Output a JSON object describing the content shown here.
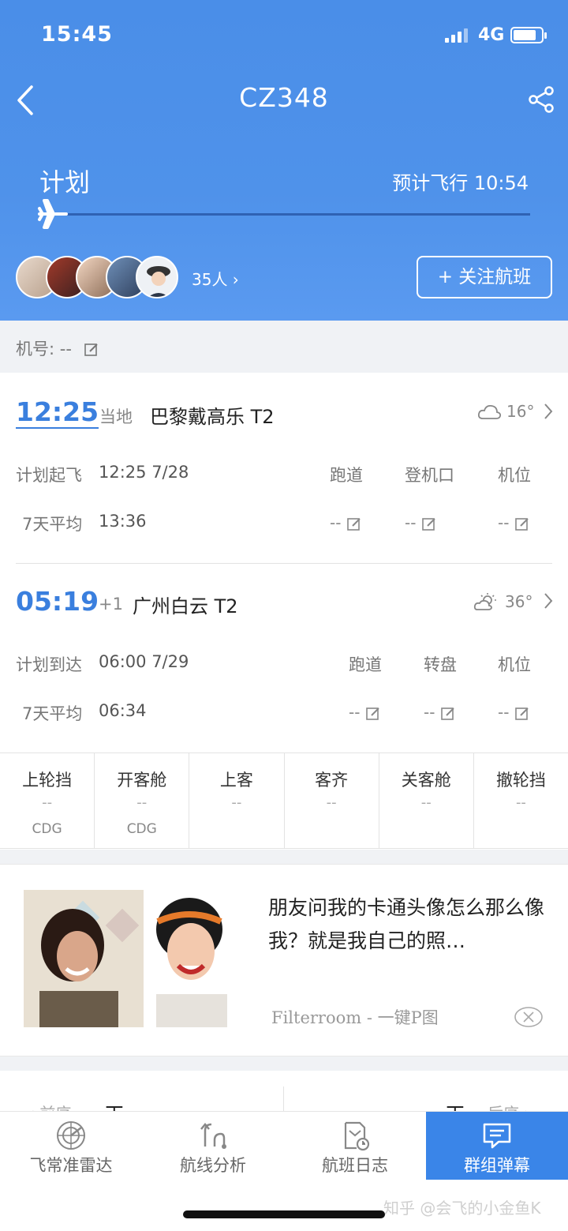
{
  "status_bar": {
    "time": "15:45",
    "network": "4G"
  },
  "header": {
    "flight_no": "CZ348",
    "status": "计划",
    "estimated": "预计飞行 10:54",
    "followers": "35人",
    "follow_button": "+ 关注航班"
  },
  "registration": {
    "label": "机号: --"
  },
  "departure": {
    "time": "12:25",
    "time_label": "当地",
    "airport": "巴黎戴高乐 T2",
    "weather": "16°",
    "scheduled_label": "计划起飞",
    "scheduled_value": "12:25 7/28",
    "avg_label": "7天平均",
    "avg_value": "13:36",
    "columns": [
      "跑道",
      "登机口",
      "机位"
    ],
    "col_values": [
      "--",
      "--",
      "--"
    ]
  },
  "arrival": {
    "time": "05:19",
    "day_offset": "+1",
    "airport": "广州白云 T2",
    "weather": "36°",
    "scheduled_label": "计划到达",
    "scheduled_value": "06:00 7/29",
    "avg_label": "7天平均",
    "avg_value": "06:34",
    "columns": [
      "跑道",
      "转盘",
      "机位"
    ],
    "col_values": [
      "--",
      "--",
      "--"
    ]
  },
  "steps": [
    {
      "name": "上轮挡",
      "value": "--",
      "code": "CDG"
    },
    {
      "name": "开客舱",
      "value": "--",
      "code": "CDG"
    },
    {
      "name": "上客",
      "value": "--",
      "code": ""
    },
    {
      "name": "客齐",
      "value": "--",
      "code": ""
    },
    {
      "name": "关客舱",
      "value": "--",
      "code": ""
    },
    {
      "name": "撤轮挡",
      "value": "--",
      "code": ""
    }
  ],
  "ad": {
    "text": "朋友问我的卡通头像怎么那么像我？就是我自己的照…",
    "source": "Filterroom - 一键P图"
  },
  "date_nav": {
    "prev": "‹ 前序",
    "prev_day": "天",
    "next_day": "天",
    "next": "后序 ›"
  },
  "tabs": [
    {
      "label": "飞常准雷达",
      "icon": "radar-icon"
    },
    {
      "label": "航线分析",
      "icon": "route-icon"
    },
    {
      "label": "航班日志",
      "icon": "log-icon"
    },
    {
      "label": "群组弹幕",
      "icon": "chat-icon"
    }
  ],
  "watermark": "知乎 @会飞的小金鱼K",
  "colors": {
    "header_blue": "#4f92ea",
    "accent": "#3a7fde",
    "active_tab": "#3a85e8"
  }
}
